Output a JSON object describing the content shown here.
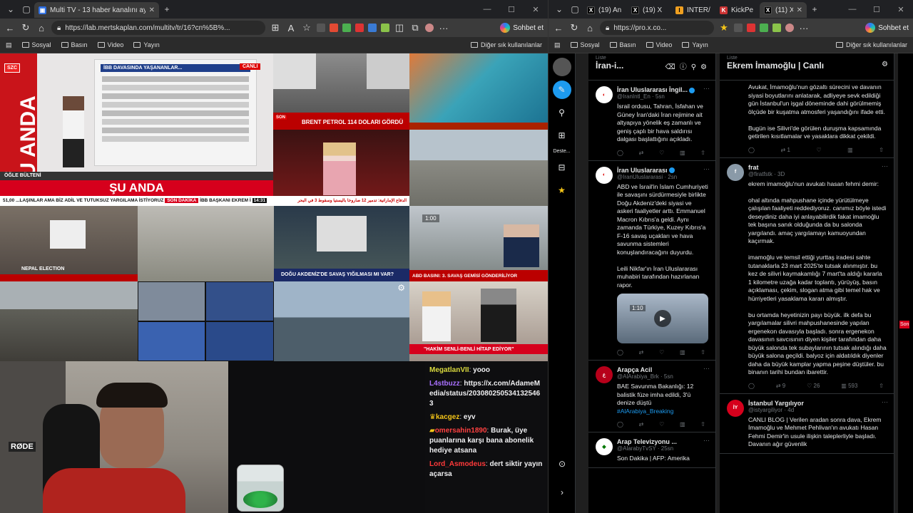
{
  "left_browser": {
    "tabs": [
      {
        "title": "Multi TV - 13 haber kanalını aynı a",
        "active": true
      }
    ],
    "url": "https://lab.mertskaplan.com/multitv/tr/16?cn%5B%...",
    "copilot_label": "Sohbet et",
    "bookmarks": [
      "Sosyal",
      "Basın",
      "Video",
      "Yayın"
    ],
    "other_bookmarks": "Diğer sık kullanılanlar"
  },
  "right_browser": {
    "tabs": [
      {
        "title": "(19) An",
        "icon": "X",
        "active": false
      },
      {
        "title": "(19) X",
        "icon": "X",
        "active": false
      },
      {
        "title": "INTER/",
        "icon": "I",
        "active": false
      },
      {
        "title": "KickPe",
        "icon": "K",
        "active": false
      },
      {
        "title": "(11) X",
        "icon": "X",
        "active": true
      }
    ],
    "url": "https://pro.x.co...",
    "copilot_label": "Sohbet et",
    "bookmarks": [
      "Sosyal",
      "Basın",
      "Video",
      "Yayın"
    ],
    "other_bookmarks": "Diğer sık kullanılanlar"
  },
  "tv_grid": {
    "szc_logo": "SZC",
    "su_anda_vertical": "ŞU ANDA",
    "su_anda_banner": "ŞU ANDA",
    "ogle_bulteni": "ÖĞLE BÜLTENİ",
    "screen_headline": "İBB DAVASINDA YAŞANANLAR...",
    "canli": "CANLI",
    "main_ticker": "...LAŞINLAR AMA BİZ ADİL VE TUTUKSUZ YARGILAMA İSTİYORUZ",
    "son_dakika": "SON DAKİKA",
    "ibb_baskani": "İBB BAŞKANI EKREM İ",
    "clock": "14:31",
    "temp": "51,00",
    "brent": "BRENT PETROL 114 DOLARI GÖRDÜ",
    "son_label": "SON",
    "dogu_akdeniz": "DOĞU AKDENİZ'DE SAVAŞ YIĞILMASI MI VAR?",
    "abd_basini": "ABD BASINI: 3. SAVAŞ GEMİSİ GÖNDERİLİYOR",
    "hakim": "\"HAKİM SENLİ-BENLİ HİTAP EDİYOR\"",
    "nepal": "NEPAL ELECTION",
    "timer": "1:00",
    "arabic_ticker": "الدفاع الإماراتية: تدمير 12 صاروخا باليستيا وسقوط 3 في البحر"
  },
  "chat": [
    {
      "user": "MegatlanVII",
      "color": "#dada3e",
      "msg": "yooo"
    },
    {
      "user": "L4stbuzz",
      "color": "#a970ff",
      "msg": "https://x.com/AdameMedia/status/2030802505341325463"
    },
    {
      "user": "kacgez",
      "color": "#f5c518",
      "msg": "eyv"
    },
    {
      "user": "omersahin1890",
      "color": "#ff4141",
      "msg": "Burak, üye puanlarına karşı bana abonelik hediye atsana"
    },
    {
      "user": "Lord_Asmodeus",
      "color": "#ff3a3a",
      "msg": "dert siktir yayın açarsa"
    }
  ],
  "cam": {
    "rode_label": "RØDE"
  },
  "xpro": {
    "rail_label": "Deste...",
    "col1": {
      "subtitle": "Liste",
      "title": "İran-i...",
      "tweets": [
        {
          "name": "İran Uluslararası İngil...",
          "handle": "@IranIntl_En · 5sn",
          "text": "İsrail ordusu, Tahran, İsfahan ve Güney İran'daki İran rejimine ait altyapıya yönelik eş zamanlı ve geniş çaplı bir hava saldırısı dalgası başlattığını açıkladı.",
          "avatar": "iran"
        },
        {
          "name": "İran Uluslararası",
          "handle": "@IranUluslararasi · 2sn",
          "text": "ABD ve İsrail'in İslam Cumhuriyeti ile savaşını sürdürmesiyle birlikte Doğu Akdeniz'deki siyasi ve askeri faaliyetler arttı. Emmanuel Macron Kıbrıs'a geldi. Aynı zamanda Türkiye, Kuzey Kıbrıs'a F-16 savaş uçakları ve hava savunma sistemleri konuşlandıracağını duyurdu.\n\nLeili Nikfar'ın İran Uluslararası muhabiri tarafından hazırlanan rapor.",
          "avatar": "iran",
          "video_time": "1:10"
        },
        {
          "name": "Arapça Acil",
          "handle": "@AlArabiya_Brk · 5sn",
          "text": "BAE Savunma Bakanlığı: 12 balistik füze imha edildi, 3'ü denize düştü",
          "tag": "#AlArabiya_Breaking",
          "avatar": "arab"
        },
        {
          "name": "Arap Televizyonu ...",
          "handle": "@AlarabyTvSY · 25sn",
          "text": "Son Dakika | AFP: Amerika",
          "avatar": "araby"
        }
      ]
    },
    "col2": {
      "subtitle": "Liste",
      "title": "Ekrem İmamoğlu | Canlı",
      "tweets": [
        {
          "name": "",
          "handle": "",
          "text": "Avukat, İmamoğlu'nun gözaltı sürecini ve davanın siyasi boyutlarını anlatarak, adliyeye sevk edildiği gün İstanbul'un işgal döneminde dahi görülmemiş ölçüde bir kuşatma atmosferi yaşandığını ifade etti.\n\nBugün ise Silivri'de görülen duruşma kapsamında getirilen kısıtlamalar ve yasaklara dikkat çekildi.",
          "replies": "",
          "retweets": "1",
          "likes": "",
          "views": "",
          "avatar": ""
        },
        {
          "name": "frat",
          "handle": "@firatfstk · 3D",
          "text": "ekrem imamoğlu'nun avukatı hasan fehmi demir:\n\nohal altında mahpushane içinde yürütülmeye çalışılan faaliyeti reddediyoruz. canımız böyle istedi deseydiniz daha iyi anlayabilirdik fakat imamoğlu tek başına sanık olduğunda da bu salonda yargılandı. amaç yargılamayı kamuoyundan kaçırmak.\n\nimamoğlu ve temsil ettiği yurttaş iradesi sahte tutanaklarla 23 mart 2025'te tutsak alınmıştır. bu kez de silivri kaymakamlığı 7 mart'ta aldığı kararla 1 kilometre uzağa kadar toplantı, yürüyüş, basın açıklaması, çekim, slogan atma gibi temel hak ve hürriyetleri yasaklama kararı almıştır.\n\nbu ortamda heyetinizin payı büyük. ilk defa bu yargılamalar silivri mahpushanesinde yapılan ergenekon davasıyla başladı. sonra ergenekon davasının savcısının diyen kişiler tarafından daha büyük salonda tek subaylarının tutsak alındığı daha büyük salona geçildi. balyoz için aldatıldık diyenler daha da büyük kamplar yapma peşine düştüler. bu binanın tarihi bundan ibarettir.",
          "replies": "",
          "retweets": "9",
          "likes": "26",
          "views": "593",
          "avatar": "frat"
        },
        {
          "name": "İstanbul Yargılıyor",
          "handle": "@istyargiliyor · 4d",
          "text": "CANLI BLOG | Verilen aradan sonra dava, Ekrem İmamoğlu ve Mehmet Pehlivan'ın avukatı Hasan Fehmi Demir'in usule ilişkin taleplerliyle başladı. Davanın ağır güvenlik",
          "avatar": "ist"
        }
      ]
    },
    "side_badge": "Son"
  },
  "colors": {
    "twitter_blue": "#1d9bf0",
    "halk_red": "#d6001c",
    "x_bg": "#000000"
  }
}
